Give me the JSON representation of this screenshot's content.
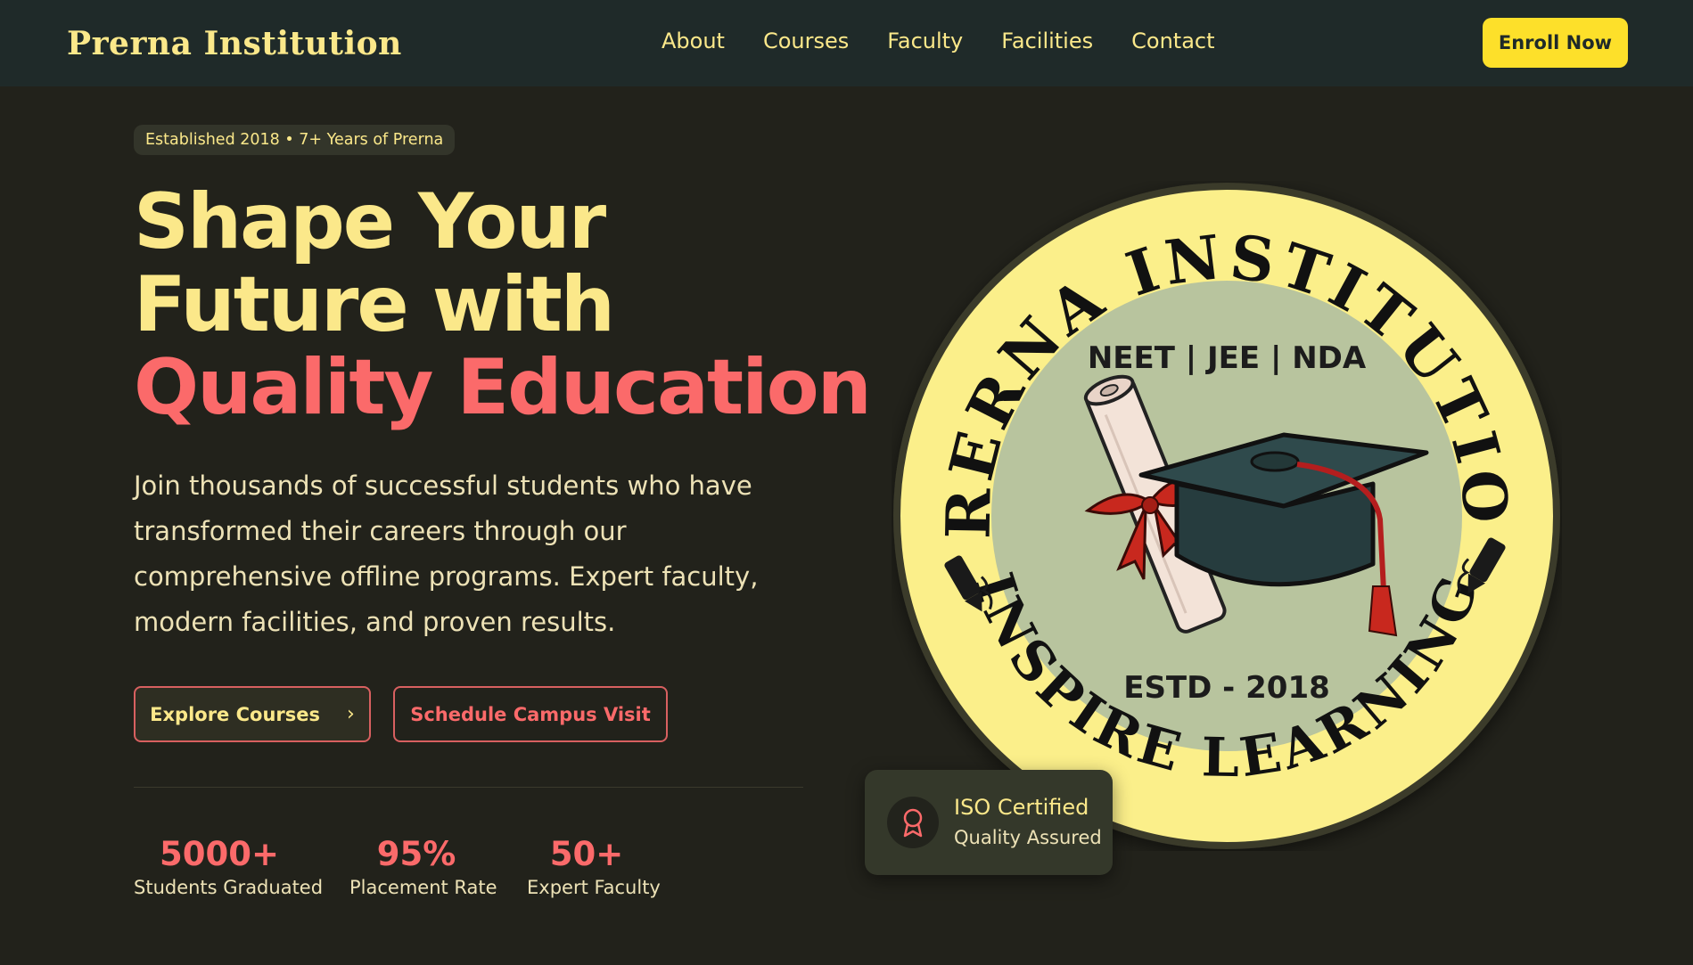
{
  "nav": {
    "brand": "Prerna Institution",
    "links": [
      "About",
      "Courses",
      "Faculty",
      "Facilities",
      "Contact"
    ],
    "cta": "Enroll Now"
  },
  "hero": {
    "badge": "Established 2018 • 7+ Years of Prerna",
    "headline_line1": "Shape Your",
    "headline_line2": "Future with",
    "headline_accent": "Quality Education",
    "lead": "Join thousands of successful students who have transformed their careers through our comprehensive offline programs. Expert faculty, modern facilities, and proven results.",
    "primary_button": "Explore Courses",
    "secondary_button": "Schedule Campus Visit",
    "stats": [
      {
        "value": "5000+",
        "label": "Students Graduated"
      },
      {
        "value": "95%",
        "label": "Placement Rate"
      },
      {
        "value": "50+",
        "label": "Expert Faculty"
      }
    ]
  },
  "seal": {
    "top_text": "PRERNA INSTITUTION",
    "bottom_text": "INSPIRE LEARNING",
    "exams": "NEET | JEE | NDA",
    "estd": "ESTD - 2018"
  },
  "iso": {
    "title": "ISO Certified",
    "subtitle": "Quality Assured",
    "icon": "award-ribbon-icon"
  },
  "colors": {
    "page_bg": "#22221b",
    "nav_bg": "#1f2a29",
    "cream": "#fbe88a",
    "coral": "#fb6a6a",
    "cta_yellow": "#fde02a"
  }
}
